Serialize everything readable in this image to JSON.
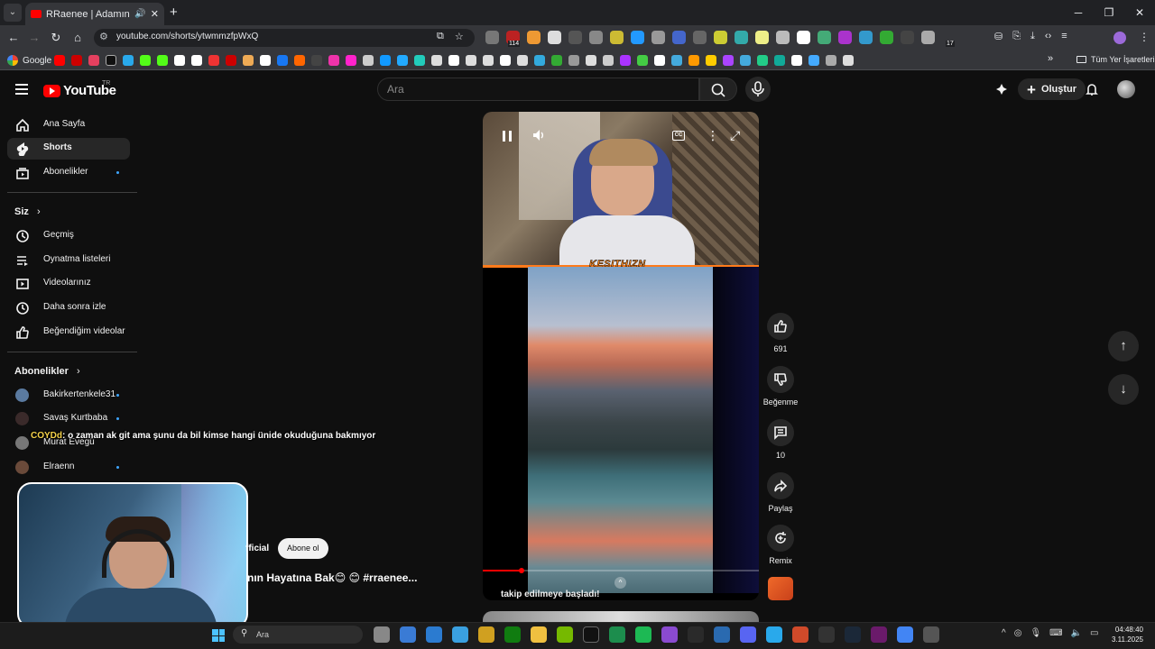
{
  "browser": {
    "tab_title": "RRaenee | Adamın Hayatına",
    "url": "youtube.com/shorts/ytwmmzfpWxQ",
    "extension_badge": "114",
    "extension_badge_2": "17",
    "bookmarks": {
      "first": "Google",
      "all_bookmarks": "Tüm Yer İşaretleri"
    }
  },
  "youtube": {
    "logo_text": "YouTube",
    "country_code": "TR",
    "search_placeholder": "Ara",
    "create_label": "Oluştur"
  },
  "sidebar": {
    "main": [
      {
        "label": "Ana Sayfa",
        "icon": "home-icon"
      },
      {
        "label": "Shorts",
        "icon": "shorts-icon",
        "active": true
      },
      {
        "label": "Abonelikler",
        "icon": "subscriptions-icon"
      }
    ],
    "you_heading": "Siz",
    "you_items": [
      {
        "label": "Geçmiş",
        "icon": "history-icon"
      },
      {
        "label": "Oynatma listeleri",
        "icon": "playlists-icon"
      },
      {
        "label": "Videolarınız",
        "icon": "your-videos-icon"
      },
      {
        "label": "Daha sonra izle",
        "icon": "watch-later-icon"
      },
      {
        "label": "Beğendiğim videolar",
        "icon": "liked-icon"
      }
    ],
    "subscriptions_heading": "Abonelikler",
    "subscriptions": [
      {
        "label": "Bakirkertenkele31",
        "avatar_color": "#5a7aa0"
      },
      {
        "label": "Savaş Kurtbaba",
        "avatar_color": "#3a2a2a"
      },
      {
        "label": "Murat Evegü",
        "avatar_color": "#777777"
      },
      {
        "label": "Elraenn",
        "avatar_color": "#6a4a3a"
      }
    ]
  },
  "short": {
    "watermark": "KESITHIZN",
    "progress_percent": 14,
    "caption": "takip edilmeye başladı!",
    "channel_suffix": "fficial",
    "subscribe_label": "Abone ol",
    "title": "nın Hayatına Bak😊 😊 #rraenee..."
  },
  "actions": {
    "like_count": "691",
    "dislike_label": "Beğenme",
    "comment_count": "10",
    "share_label": "Paylaş",
    "remix_label": "Remix"
  },
  "overlay": {
    "chat_user": "COYDd",
    "chat_message": ": o zaman ak git ama şunu da bil kimse hangi ünide okuduğuna bakmıyor"
  },
  "taskbar": {
    "search_label": "Ara",
    "time": "04:48:40",
    "date": "3.11.2025"
  },
  "colors": {
    "yt_red": "#ff0000",
    "accent_blue": "#3ea6ff",
    "bg": "#0f0f0f"
  }
}
